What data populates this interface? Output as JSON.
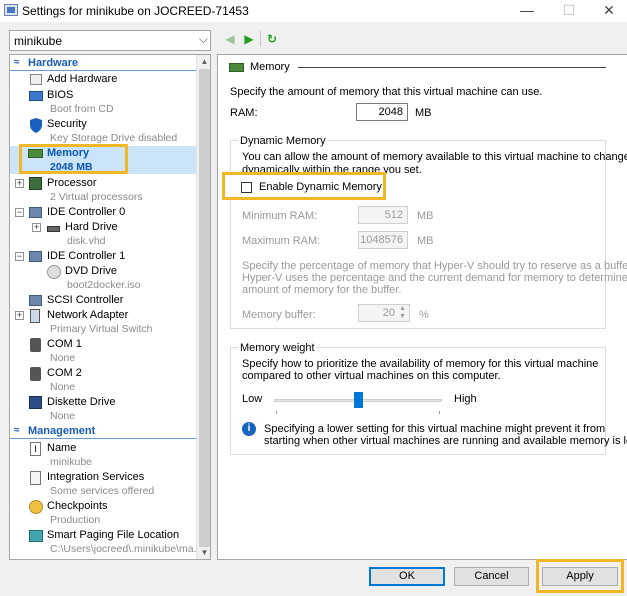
{
  "window": {
    "title": "Settings for minikube on JOCREED-71453",
    "minimize": "—",
    "maximize": "☐",
    "close": "✕"
  },
  "vm_select": {
    "value": "minikube"
  },
  "toolbar": {
    "back": "◀",
    "forward": "▶",
    "refresh": "↻"
  },
  "tree": {
    "hardware_header": "Hardware",
    "management_header": "Management",
    "items": {
      "add_hardware": {
        "label": "Add Hardware"
      },
      "bios": {
        "label": "BIOS",
        "sub": "Boot from CD"
      },
      "security": {
        "label": "Security",
        "sub": "Key Storage Drive disabled"
      },
      "memory": {
        "label": "Memory",
        "sub": "2048 MB"
      },
      "processor": {
        "label": "Processor",
        "sub": "2 Virtual processors"
      },
      "ide0": {
        "label": "IDE Controller 0"
      },
      "hard_drive": {
        "label": "Hard Drive",
        "sub": "disk.vhd"
      },
      "ide1": {
        "label": "IDE Controller 1"
      },
      "dvd_drive": {
        "label": "DVD Drive",
        "sub": "boot2docker.iso"
      },
      "scsi": {
        "label": "SCSI Controller"
      },
      "network": {
        "label": "Network Adapter",
        "sub": "Primary Virtual Switch"
      },
      "com1": {
        "label": "COM 1",
        "sub": "None"
      },
      "com2": {
        "label": "COM 2",
        "sub": "None"
      },
      "diskette": {
        "label": "Diskette Drive",
        "sub": "None"
      },
      "name": {
        "label": "Name",
        "sub": "minikube"
      },
      "integration": {
        "label": "Integration Services",
        "sub": "Some services offered"
      },
      "checkpoints": {
        "label": "Checkpoints",
        "sub": "Production"
      },
      "paging": {
        "label": "Smart Paging File Location",
        "sub": "C:\\Users\\jocreed\\.minikube\\ma..."
      }
    }
  },
  "memory_panel": {
    "title": "Memory",
    "description": "Specify the amount of memory that this virtual machine can use.",
    "ram_label": "RAM:",
    "ram_value": "2048",
    "ram_unit": "MB",
    "dynamic": {
      "title": "Dynamic Memory",
      "desc_line1": "You can allow the amount of memory available to this virtual machine to change",
      "desc_line2": "dynamically within the range you set.",
      "enable_label": "Enable Dynamic Memory",
      "enabled": false,
      "min_label": "Minimum RAM:",
      "min_value": "512",
      "max_label": "Maximum RAM:",
      "max_value": "1048576",
      "unit": "MB",
      "buffer_desc1": "Specify the percentage of memory that Hyper-V should try to reserve as a buffer.",
      "buffer_desc2": "Hyper-V uses the percentage and the current demand for memory to determine an",
      "buffer_desc3": "amount of memory for the buffer.",
      "buffer_label": "Memory buffer:",
      "buffer_value": "20",
      "buffer_unit": "%"
    },
    "weight": {
      "title": "Memory weight",
      "desc1": "Specify how to prioritize the availability of memory for this virtual machine",
      "desc2": "compared to other virtual machines on this computer.",
      "low": "Low",
      "high": "High",
      "slider_fraction": 0.5,
      "info1": "Specifying a lower setting for this virtual machine might prevent it from",
      "info2": "starting when other virtual machines are running and available memory is low."
    }
  },
  "buttons": {
    "ok": "OK",
    "cancel": "Cancel",
    "apply": "Apply"
  },
  "colors": {
    "accent": "#0078d7",
    "highlight": "#f3b624",
    "selected": "#cce4f7"
  }
}
